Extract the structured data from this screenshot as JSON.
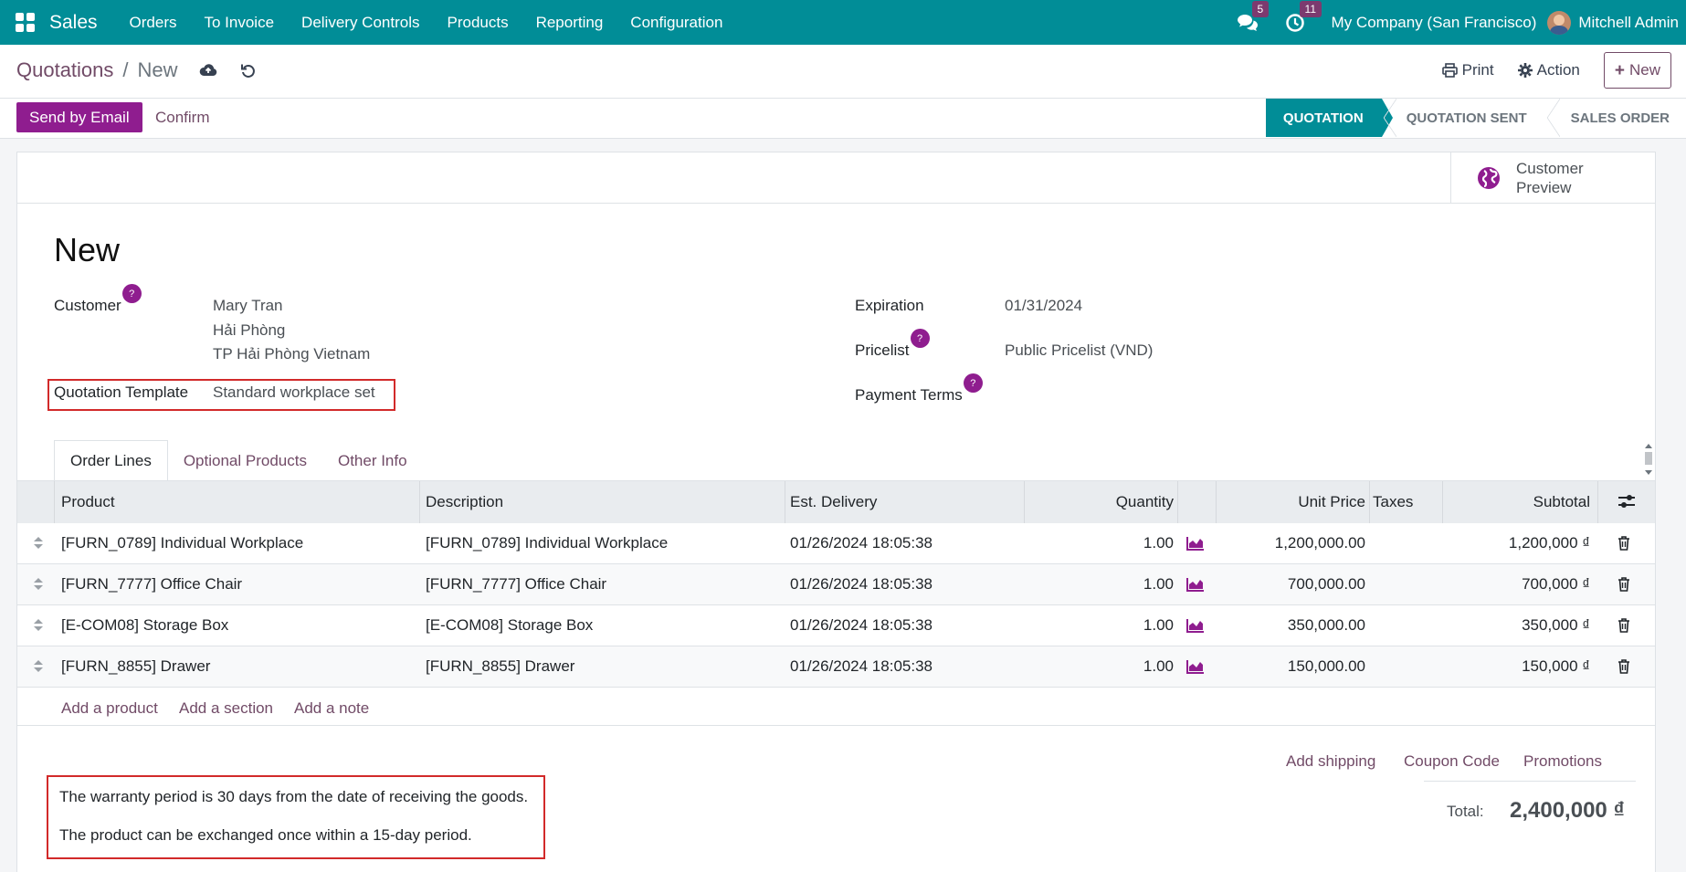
{
  "navbar": {
    "app_name": "Sales",
    "menu": [
      "Orders",
      "To Invoice",
      "Delivery Controls",
      "Products",
      "Reporting",
      "Configuration"
    ],
    "messages_count": "5",
    "activities_count": "11",
    "company": "My Company (San Francisco)",
    "user": "Mitchell Admin"
  },
  "control_panel": {
    "breadcrumb_parent": "Quotations",
    "breadcrumb_sep": "/",
    "breadcrumb_current": "New",
    "print_label": "Print",
    "action_label": "Action",
    "new_label": "New"
  },
  "statusbar": {
    "send_email_label": "Send by Email",
    "confirm_label": "Confirm",
    "stages": [
      "QUOTATION",
      "QUOTATION SENT",
      "SALES ORDER"
    ],
    "active_stage": "QUOTATION"
  },
  "sheet": {
    "customer_preview_label": "Customer Preview",
    "title": "New",
    "fields": {
      "customer_label": "Customer",
      "customer_name": "Mary Tran",
      "customer_addr1": "Hải Phòng",
      "customer_addr2": "TP Hải Phòng Vietnam",
      "template_label": "Quotation Template",
      "template_value": "Standard workplace set",
      "expiration_label": "Expiration",
      "expiration_value": "01/31/2024",
      "pricelist_label": "Pricelist",
      "pricelist_value": "Public Pricelist (VND)",
      "payment_terms_label": "Payment Terms",
      "help_mark": "?"
    },
    "tabs": [
      "Order Lines",
      "Optional Products",
      "Other Info"
    ],
    "table": {
      "headers": [
        "Product",
        "Description",
        "Est. Delivery",
        "Quantity",
        "Unit Price",
        "Taxes",
        "Subtotal"
      ],
      "rows": [
        {
          "product": "[FURN_0789] Individual Workplace",
          "description": "[FURN_0789] Individual Workplace",
          "delivery": "01/26/2024 18:05:38",
          "quantity": "1.00",
          "unit_price": "1,200,000.00",
          "taxes": "",
          "subtotal": "1,200,000 ₫"
        },
        {
          "product": "[FURN_7777] Office Chair",
          "description": "[FURN_7777] Office Chair",
          "delivery": "01/26/2024 18:05:38",
          "quantity": "1.00",
          "unit_price": "700,000.00",
          "taxes": "",
          "subtotal": "700,000 ₫"
        },
        {
          "product": "[E-COM08] Storage Box",
          "description": "[E-COM08] Storage Box",
          "delivery": "01/26/2024 18:05:38",
          "quantity": "1.00",
          "unit_price": "350,000.00",
          "taxes": "",
          "subtotal": "350,000 ₫"
        },
        {
          "product": "[FURN_8855] Drawer",
          "description": "[FURN_8855] Drawer",
          "delivery": "01/26/2024 18:05:38",
          "quantity": "1.00",
          "unit_price": "150,000.00",
          "taxes": "",
          "subtotal": "150,000 ₫"
        }
      ],
      "add_product": "Add a product",
      "add_section": "Add a section",
      "add_note": "Add a note"
    },
    "footer": {
      "add_shipping": "Add shipping",
      "coupon_code": "Coupon Code",
      "promotions": "Promotions",
      "total_label": "Total:",
      "total_value": "2,400,000 ₫",
      "note_line1": "The warranty period is 30 days from the date of receiving the goods.",
      "note_line2": "The product can be exchanged once within a 15-day period."
    }
  },
  "colors": {
    "navbar": "#018d97",
    "primary": "#8f1d8f",
    "link": "#714b67",
    "highlight_box": "#d22a2a"
  }
}
